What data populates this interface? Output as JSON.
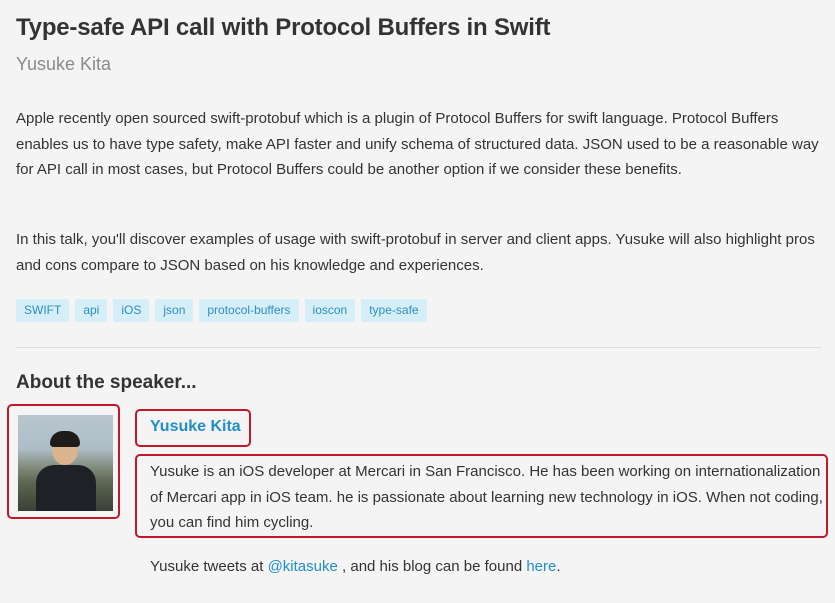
{
  "talk": {
    "title": "Type-safe API call with Protocol Buffers in Swift",
    "author": "Yusuke Kita",
    "abstract_p1": "Apple recently open sourced swift-protobuf which is a plugin of Protocol Buffers for swift language. Protocol Buffers enables us to have type safety, make API faster and unify schema of structured data. JSON used to be a reasonable way for API call in most cases, but Protocol Buffers could be another option if we consider these benefits.",
    "abstract_p2": "In this talk, you'll discover examples of usage with swift-protobuf in server and client apps. Yusuke will also highlight pros and cons compare to JSON based on his knowledge and experiences."
  },
  "tags": [
    "SWIFT",
    "api",
    "iOS",
    "json",
    "protocol-buffers",
    "ioscon",
    "type-safe"
  ],
  "speaker": {
    "heading": "About the speaker...",
    "name": "Yusuke Kita",
    "bio": "Yusuke is an iOS developer at Mercari in San Francisco. He has been working on internationalization of Mercari app in iOS team. he is passionate about learning new technology in iOS. When not coding, you can find him cycling.",
    "links_prefix": "Yusuke tweets at",
    "twitter": "@kitasuke",
    "links_middle": ", and his blog can be found",
    "blog": "here",
    "links_suffix": "."
  },
  "colors": {
    "link": "#1f8fc7",
    "tag_bg": "#d6eef7",
    "highlight_border": "#c0182a"
  }
}
